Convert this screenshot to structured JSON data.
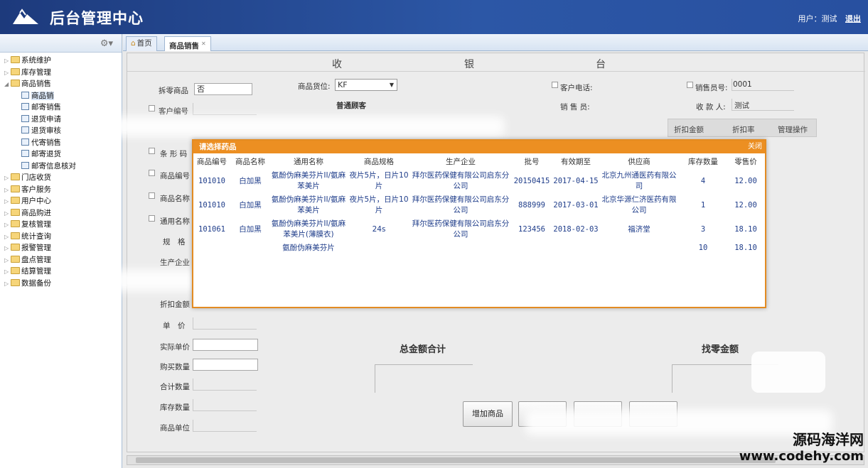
{
  "header": {
    "title": "后台管理中心",
    "user_label": "用户：测试",
    "logout": "退出"
  },
  "sidebar": {
    "items": [
      {
        "label": "系统维护",
        "type": "folder"
      },
      {
        "label": "库存管理",
        "type": "folder"
      },
      {
        "label": "商品销售",
        "type": "folder-open"
      },
      {
        "label": "商品销",
        "type": "page",
        "active": true
      },
      {
        "label": "邮寄销售",
        "type": "page"
      },
      {
        "label": "退货申请",
        "type": "page"
      },
      {
        "label": "退货审核",
        "type": "page"
      },
      {
        "label": "代寄销售",
        "type": "page"
      },
      {
        "label": "邮寄退货",
        "type": "page"
      },
      {
        "label": "邮寄信息核对",
        "type": "page"
      },
      {
        "label": "门店收货",
        "type": "folder"
      },
      {
        "label": "客户服务",
        "type": "folder"
      },
      {
        "label": "用户中心",
        "type": "folder"
      },
      {
        "label": "商品购进",
        "type": "folder"
      },
      {
        "label": "复核管理",
        "type": "folder"
      },
      {
        "label": "统计查询",
        "type": "folder"
      },
      {
        "label": "报警管理",
        "type": "folder"
      },
      {
        "label": "盘点管理",
        "type": "folder"
      },
      {
        "label": "结算管理",
        "type": "folder"
      },
      {
        "label": "数据备份",
        "type": "folder"
      }
    ]
  },
  "tabs": [
    {
      "label": "首页"
    },
    {
      "label": "商品销售"
    }
  ],
  "cashier": {
    "c1": "收",
    "c2": "银",
    "c3": "台"
  },
  "form": {
    "split_label": "拆零商品",
    "split_value": "否",
    "location_label": "商品货位:",
    "location_value": "KF",
    "customer_phone_label": "客户电话:",
    "salesman_no_label": "销售员号:",
    "salesman_no_value": "0001",
    "customer_type": "普通顾客",
    "salesman_label": "销 售 员:",
    "receiver_label": "收 款 人:",
    "receiver_value": "测试",
    "customer_no_label": "客户编号",
    "barcode_label": "条 形 码",
    "product_no_label": "商品编号",
    "product_name_label": "商品名称",
    "generic_name_label": "通用名称",
    "spec_label": "规　格",
    "manufacturer_label": "生产企业",
    "discount_amount_label": "折扣金额",
    "unit_price_label": "单　价",
    "actual_price_label": "实际单价",
    "quantity_label": "购买数量",
    "total_qty_label": "合计数量",
    "stock_qty_label": "库存数量",
    "unit_label": "商品单位"
  },
  "grid": {
    "discount_amount": "折扣金额",
    "discount_rate": "折扣率",
    "manage": "管理操作"
  },
  "totals": {
    "total_label": "总金额合计",
    "change_label": "找零金额"
  },
  "buttons": {
    "add_product": "增加商品"
  },
  "dialog": {
    "title": "请选择药品",
    "close": "关闭",
    "columns": [
      "商品编号",
      "商品名称",
      "通用名称",
      "商品规格",
      "生产企业",
      "批号",
      "有效期至",
      "供应商",
      "库存数量",
      "零售价"
    ],
    "rows": [
      [
        "101010",
        "白加黑",
        "氨酚伪麻美芬片II/氨麻苯美片",
        "夜片5片，日片10片",
        "拜尔医药保健有限公司启东分公司",
        "20150415",
        "2017-04-15",
        "北京九州通医药有限公司",
        "4",
        "12.00"
      ],
      [
        "101010",
        "白加黑",
        "氨酚伪麻美芬片II/氨麻苯美片",
        "夜片5片，日片10片",
        "拜尔医药保健有限公司启东分公司",
        "888999",
        "2017-03-01",
        "北京华源仁济医药有限公司",
        "1",
        "12.00"
      ],
      [
        "101061",
        "白加黑",
        "氨酚伪麻美芬片II/氨麻苯美片(薄膜衣)",
        "24s",
        "拜尔医药保健有限公司启东分公司",
        "123456",
        "2018-02-03",
        "福济堂",
        "3",
        "18.10"
      ],
      [
        "",
        "",
        "氨酚伪麻美芬片",
        "",
        "",
        "",
        "",
        "",
        "10",
        "18.10"
      ]
    ]
  },
  "watermark": {
    "line1": "源码海洋网",
    "line2": "www.codehy.com"
  }
}
